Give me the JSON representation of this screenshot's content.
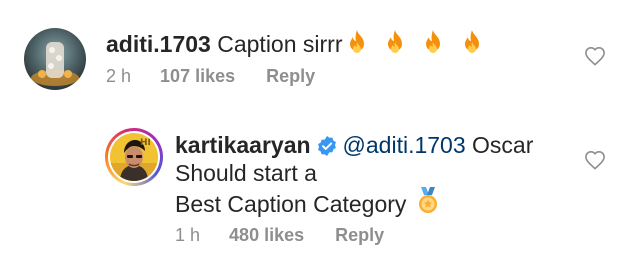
{
  "comments": [
    {
      "username": "aditi.1703",
      "text": "Caption sirrr",
      "emoji_count": 4,
      "time": "2 h",
      "likes": "107 likes",
      "reply": "Reply"
    },
    {
      "username": "kartikaaryan",
      "verified": true,
      "mention": "@aditi.1703",
      "text_line1": "Oscar",
      "text_line2": "Should start a",
      "text_line3": "Best Caption Category",
      "time": "1 h",
      "likes": "480 likes",
      "reply": "Reply"
    }
  ],
  "icons": {
    "fire": "fire-emoji-icon",
    "medal": "medal-emoji-icon",
    "heart": "heart-outline-icon",
    "verified": "verified-badge-icon"
  },
  "colors": {
    "text": "#262626",
    "muted": "#8e8e8e",
    "mention": "#00376b",
    "verified": "#3897f0"
  }
}
